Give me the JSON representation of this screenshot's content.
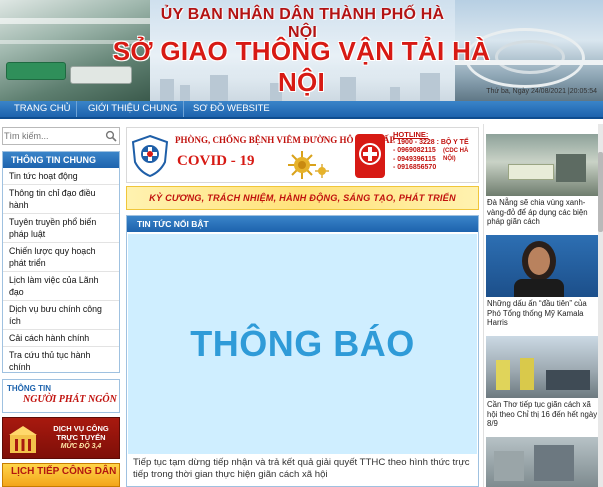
{
  "header": {
    "top_title": "ỦY BAN NHÂN DÂN THÀNH PHỐ HÀ NỘI",
    "main_title": "SỞ GIAO THÔNG VẬN TẢI HÀ NỘI",
    "datetime": "Thứ ba, Ngày 24/08/2021 |20:05:54"
  },
  "nav": {
    "items": [
      {
        "label": "TRANG CHỦ"
      },
      {
        "label": "GIỚI THIỆU CHUNG"
      },
      {
        "label": "SƠ ĐỒ WEBSITE"
      }
    ]
  },
  "search": {
    "placeholder": "Tìm kiếm..."
  },
  "menu": {
    "heading": "THÔNG TIN CHUNG",
    "items": [
      {
        "label": "Tin tức hoạt động"
      },
      {
        "label": "Thông tin chỉ đạo điều hành"
      },
      {
        "label": "Tuyên truyền phổ biến pháp luật"
      },
      {
        "label": "Chiến lược quy hoạch phát triển"
      },
      {
        "label": "Lịch làm việc của Lãnh đạo"
      },
      {
        "label": "Dịch vụ bưu chính công ích"
      },
      {
        "label": "Cải cách hành chính"
      },
      {
        "label": "Tra cứu thủ tục hành chính"
      }
    ]
  },
  "nguoi_phat_ngon": {
    "line1": "THÔNG TIN",
    "line2": "NGƯỜI PHÁT NGÔN"
  },
  "dich_vu_cong": {
    "line1": "DỊCH VỤ CÔNG TRỰC TUYẾN",
    "line2": "MỨC ĐỘ 3,4"
  },
  "lich_tiep": {
    "label": "LỊCH TIẾP CÔNG DÂN"
  },
  "covid_banner": {
    "line1": "PHÒNG, CHỐNG BỆNH VIÊM ĐƯỜNG HÔ HẤP CẤP",
    "line2": "COVID - 19",
    "hotline_label": "HOTLINE:",
    "hotline_lines": [
      "- 1900 - 3228 : BỘ Y TẾ",
      "- 0969082115",
      "- 0949396115",
      "- 0916856570"
    ],
    "hotline_note": "(CDC HÀ NỘI)"
  },
  "slogan": "KỶ CƯƠNG, TRÁCH NHIỆM, HÀNH ĐỘNG, SÁNG TẠO, PHÁT TRIỂN",
  "featured": {
    "heading": "TIN TỨC NỔI BẬT",
    "image_text": "THÔNG BÁO",
    "caption": "Tiếp tục tạm dừng tiếp nhận và trả kết quả giải quyết TTHC theo hình thức trực tiếp trong thời gian thực hiện giãn cách xã hội"
  },
  "side_news": [
    {
      "title": "Đà Nẵng sẽ chia vùng xanh-vàng-đỏ để áp dụng các biện pháp giãn cách"
    },
    {
      "title": "Những dấu ấn “đầu tiên” của Phó Tổng thống Mỹ Kamala Harris"
    },
    {
      "title": "Cần Thơ tiếp tục giãn cách xã hội theo Chỉ thị 16 đến hết ngày 8/9"
    },
    {
      "title": ""
    }
  ],
  "colors": {
    "nav_blue": "#1d63ad",
    "title_red": "#d71a14",
    "slogan_bg": "#ffe27a",
    "thongbao_bg": "#cfeeff",
    "thongbao_text": "#2f9bd8"
  }
}
